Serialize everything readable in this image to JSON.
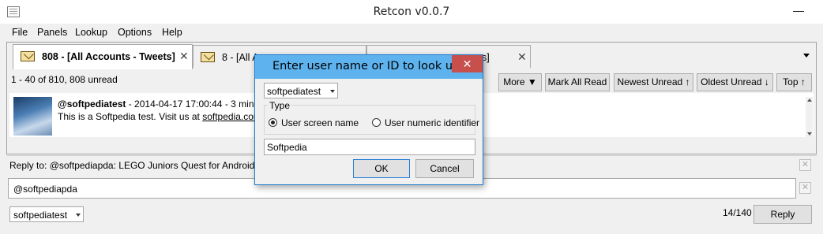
{
  "window": {
    "title": "Retcon v0.0.7"
  },
  "menu": [
    "File",
    "Panels",
    "Lookup",
    "Options",
    "Help"
  ],
  "tabs": [
    {
      "label": "808 - [All Accounts - Tweets]",
      "active": true
    },
    {
      "label": "8 - [All Ac",
      "active": false
    },
    {
      "label": "s]",
      "active": false
    }
  ],
  "timeline": {
    "count": "1 - 40 of 810, 808 unread",
    "buttons": {
      "more": "More ▼",
      "mark_all_read": "Mark All Read",
      "newest_unread": "Newest Unread ↑",
      "oldest_unread": "Oldest Unread ↓",
      "top": "Top ↑"
    },
    "tweet": {
      "user": "@softpediatest",
      "meta": " - 2014-04-17 17:00:44 - 3 minute",
      "text": "This is a Softpedia test. Visit us at ",
      "link": "softpedia.com"
    }
  },
  "reply": {
    "to": "Reply to: @softpediapda: LEGO Juniors Quest for Android 1.0.0",
    "compose_value": "@softpediapda",
    "account": "softpediatest",
    "char_count": "14/140",
    "reply_button": "Reply"
  },
  "dialog": {
    "title": "Enter user name or ID to look up",
    "account": "softpediatest",
    "type_label": "Type",
    "option_screen_name": "User screen name",
    "option_numeric_id": "User numeric identifier",
    "selected": "screen_name",
    "input_value": "Softpedia",
    "ok": "OK",
    "cancel": "Cancel"
  }
}
